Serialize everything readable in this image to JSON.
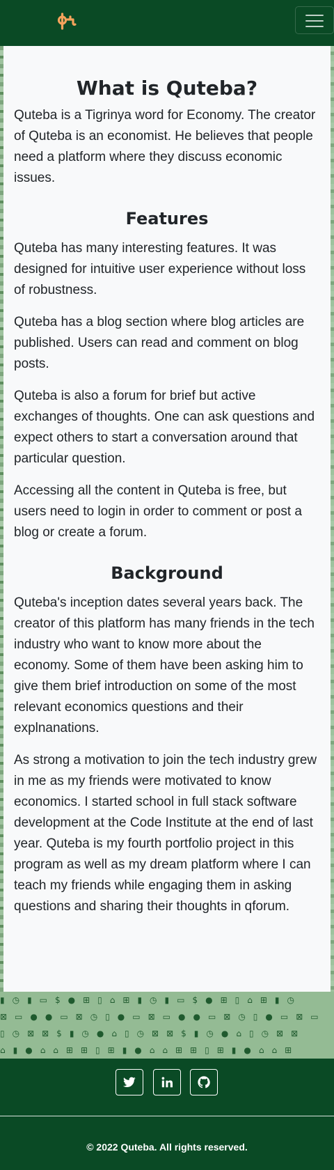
{
  "navbar": {
    "brand_logo": "ቁ",
    "brand_color": "#f5a35c",
    "menu_icon": "hamburger-icon",
    "background": "#0a4a25"
  },
  "content": {
    "title": "What is Quteba?",
    "intro": "Quteba is a Tigrinya word for Economy. The creator of Quteba is an economist. He believes that people need a platform where they discuss economic issues.",
    "features_heading": "Features",
    "features_paragraphs": [
      "Quteba has many interesting features. It was designed for intuitive user experience without loss of robustness.",
      "Quteba has a blog section where blog articles are published. Users can read and comment on blog posts.",
      "Quteba is also a forum for brief but active exchanges of thoughts. One can ask questions and expect others to start a conversation around that particular question.",
      "Accessing all the content in Quteba is free, but users need to login in order to comment or post a blog or create a forum."
    ],
    "background_heading": "Background",
    "background_paragraphs": [
      "Quteba's inception dates several years back. The creator of this platform has many friends in the tech industry who want to know more about the economy. Some of them have been asking him to give them brief introduction on some of the most relevant economics questions and their explnanations.",
      "As strong a motivation to join the tech industry grew in me as my friends were motivated to know economics. I started school in full stack software development at the Code Institute at the end of last year. Quteba is my fourth portfolio project in this program as well as my dream platform where I can teach my friends while engaging them in asking questions and sharing their thoughts in qforum."
    ]
  },
  "footer": {
    "social_links": [
      {
        "name": "twitter",
        "icon": "twitter-icon"
      },
      {
        "name": "linkedin",
        "icon": "linkedin-icon"
      },
      {
        "name": "github",
        "icon": "github-icon"
      }
    ],
    "copyright": "© 2022 Quteba. All rights reserved."
  }
}
